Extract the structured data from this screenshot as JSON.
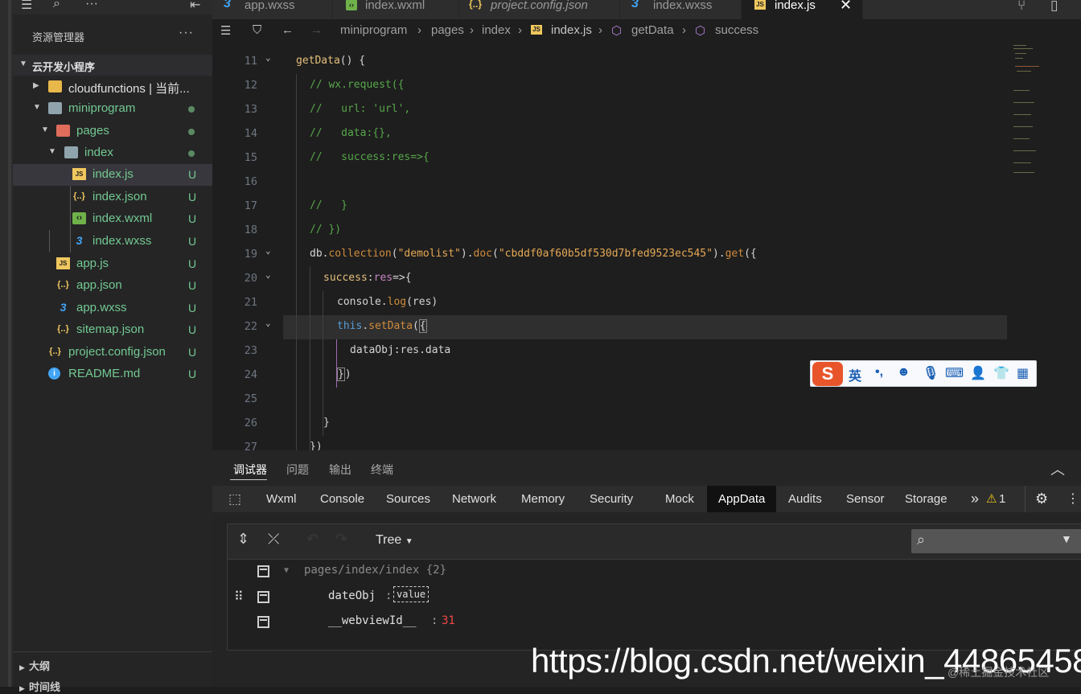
{
  "sidebar": {
    "title": "资源管理器",
    "more": "···",
    "project": "云开发小程序",
    "tree": [
      {
        "label": "cloudfunctions | 当前...",
        "mark": ""
      },
      {
        "label": "miniprogram",
        "mark": "dot"
      },
      {
        "label": "pages",
        "mark": "dot"
      },
      {
        "label": "index",
        "mark": "dot"
      },
      {
        "label": "index.js",
        "mark": "U"
      },
      {
        "label": "index.json",
        "mark": "U"
      },
      {
        "label": "index.wxml",
        "mark": "U"
      },
      {
        "label": "index.wxss",
        "mark": "U"
      },
      {
        "label": "app.js",
        "mark": "U"
      },
      {
        "label": "app.json",
        "mark": "U"
      },
      {
        "label": "app.wxss",
        "mark": "U"
      },
      {
        "label": "sitemap.json",
        "mark": "U"
      },
      {
        "label": "project.config.json",
        "mark": "U"
      },
      {
        "label": "README.md",
        "mark": "U"
      }
    ],
    "outline": "大纲",
    "timeline": "时间线"
  },
  "tabs": [
    {
      "label": "app.wxss",
      "icon": "wxss-icon"
    },
    {
      "label": "index.wxml",
      "icon": "wxml-icon"
    },
    {
      "label": "project.config.json",
      "icon": "json-icon"
    },
    {
      "label": "index.wxss",
      "icon": "wxss-icon"
    },
    {
      "label": "index.js",
      "icon": "js-icon",
      "active": true
    }
  ],
  "breadcrumb": [
    "miniprogram",
    "pages",
    "index",
    "index.js",
    "getData",
    "success"
  ],
  "code": {
    "lines": [
      11,
      12,
      13,
      14,
      15,
      16,
      17,
      18,
      19,
      20,
      21,
      22,
      23,
      24,
      25,
      26,
      27
    ],
    "collection": "\"demolist\"",
    "doc_id": "\"cbddf0af60b5df530d7bfed9523ec545\""
  },
  "ime": {
    "label": "英"
  },
  "panel": {
    "tabs": [
      "调试器",
      "问题",
      "输出",
      "终端"
    ],
    "devtools": [
      "Wxml",
      "Console",
      "Sources",
      "Network",
      "Memory",
      "Security",
      "Mock",
      "AppData",
      "Audits",
      "Sensor",
      "Storage"
    ],
    "more": "»",
    "warning_count": "1",
    "view_mode": "Tree"
  },
  "appdata": {
    "root": "pages/index/index {2}",
    "rows": [
      {
        "key": "dateObj",
        "value": "value"
      },
      {
        "key": "__webviewId__",
        "value": "31"
      }
    ]
  },
  "watermark": {
    "url": "https://blog.csdn.net/weixin_44865458",
    "community": "@稀土掘金技术社区"
  },
  "colors": {
    "accent": "#000000",
    "string": "#e6a855",
    "comment": "#57a64a",
    "number": "#f44747"
  }
}
